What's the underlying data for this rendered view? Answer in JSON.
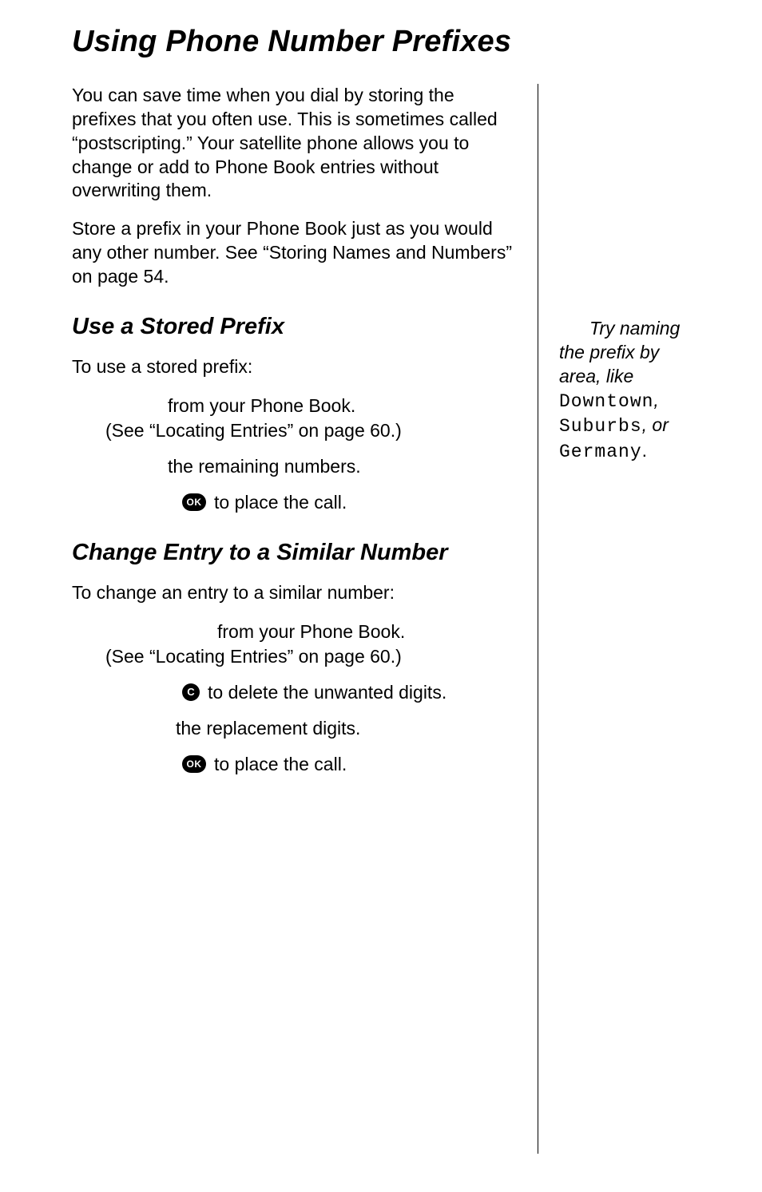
{
  "title": "Using Phone Number Prefixes",
  "intro_p1": "You can save time when you dial by storing the prefixes that you often use. This is sometimes called “postscripting.” Your satellite phone allows you to change or add to Phone Book entries without overwriting them.",
  "intro_p2": "Store a prefix in your Phone Book just as you would any other number. See “Storing Names and Numbers” on page 54.",
  "section1": {
    "heading": "Use a Stored Prefix",
    "lead": "To use a stored prefix:",
    "step1_line1": "from your Phone Book.",
    "step1_line2": "(See “Locating Entries” on page 60.)",
    "step2": "the remaining numbers.",
    "ok_label": "OK",
    "step3": "to place the call."
  },
  "section2": {
    "heading": "Change Entry to a Similar Number",
    "lead": "To change an entry to a similar number:",
    "step1_line1": "from your Phone Book.",
    "step1_line2": "(See “Locating Entries” on page 60.)",
    "c_label": "C",
    "step2": "to delete the unwanted digits.",
    "step3": "the replacement digits.",
    "ok_label": "OK",
    "step4": "to place the call."
  },
  "tip": {
    "line1": "Try naming",
    "line2a": "the prefix by",
    "line2b": "area, like",
    "ex1": "Downtown",
    "sep1": ",",
    "ex2": "Suburbs",
    "sep2": ", or",
    "ex3": "Germany",
    "end": "."
  }
}
